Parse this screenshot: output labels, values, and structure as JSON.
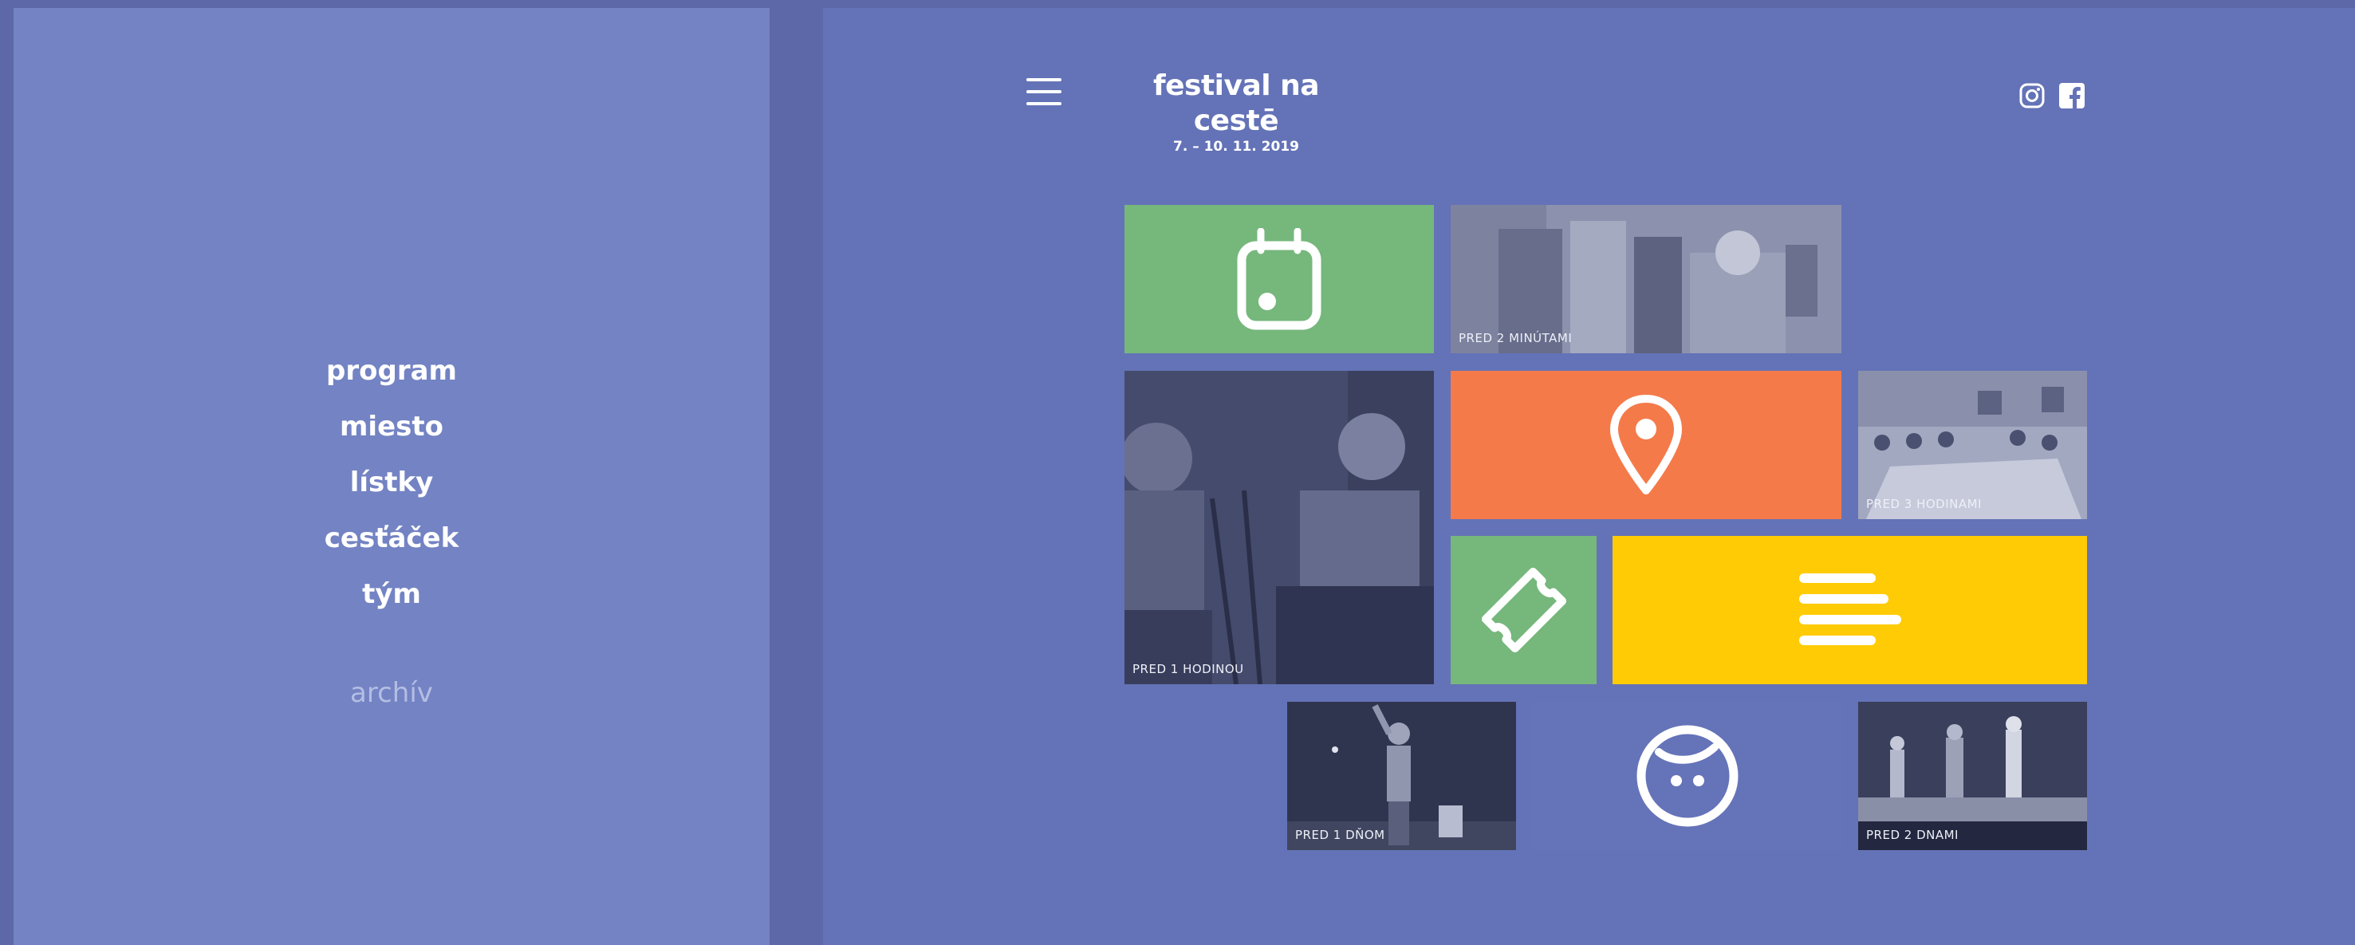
{
  "sidebar": {
    "nav": [
      "program",
      "miesto",
      "lístky",
      "cesťáček",
      "tým"
    ],
    "archive": "archív"
  },
  "header": {
    "title": "festival na cestē",
    "date": "7. – 10. 11. 2019"
  },
  "tiles": {
    "photo1_caption": "PRED 2 MINÚTAMI",
    "photo2_caption": "PRED 1 HODINOU",
    "photo3_caption": "PRED 3 HODINAMI",
    "photo4_caption": "PRED 1 DŇOM",
    "photo5_caption": "PRED 2 DNAMI"
  },
  "colors": {
    "green": "#76b77c",
    "orange": "#f47a4a",
    "yellow": "#ffcb05",
    "blue": "#6573b8"
  },
  "icons": [
    "menu-icon",
    "instagram-icon",
    "facebook-icon",
    "calendar-icon",
    "location-pin-icon",
    "ticket-icon",
    "text-lines-icon",
    "kid-face-icon"
  ]
}
